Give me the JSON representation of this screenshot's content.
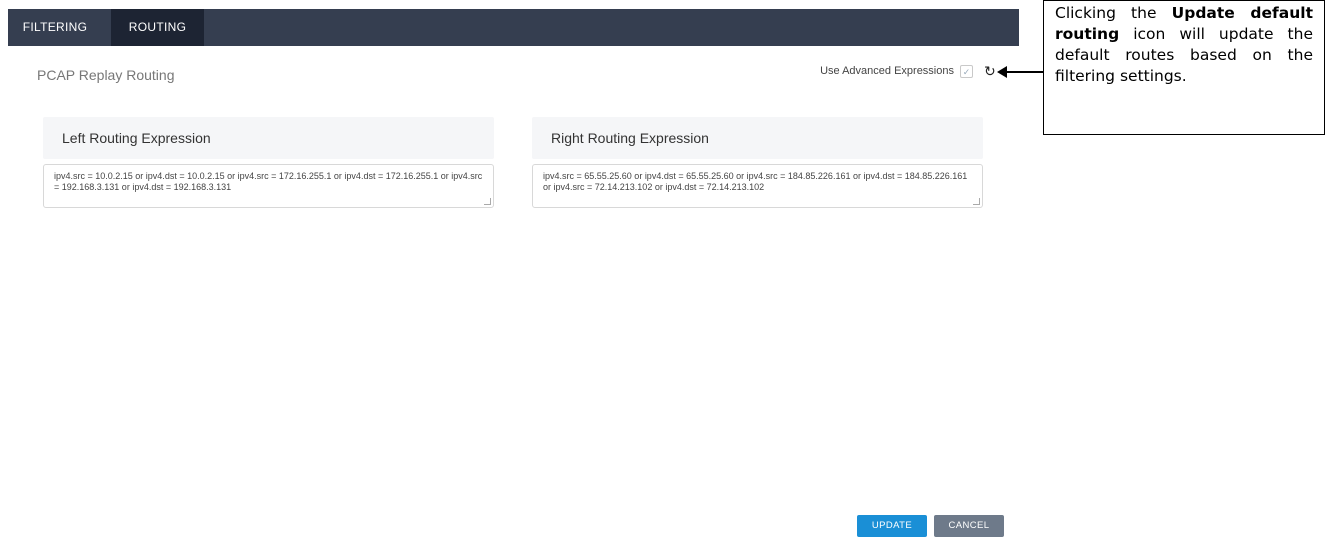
{
  "tabs": {
    "filtering": "FILTERING",
    "routing": "ROUTING"
  },
  "page_title": "PCAP Replay Routing",
  "advanced": {
    "label": "Use Advanced Expressions",
    "checkmark": "✓"
  },
  "icons": {
    "refresh": "↻"
  },
  "callout": {
    "part1": "Clicking the ",
    "bold": "Update default routing",
    "part2": " icon will update the default routes based on the filtering settings."
  },
  "left_panel": {
    "title": "Left Routing Expression",
    "expression": "ipv4.src = 10.0.2.15 or ipv4.dst = 10.0.2.15  or ipv4.src = 172.16.255.1 or ipv4.dst = 172.16.255.1  or ipv4.src = 192.168.3.131 or ipv4.dst = 192.168.3.131"
  },
  "right_panel": {
    "title": "Right Routing Expression",
    "expression": "ipv4.src = 65.55.25.60 or ipv4.dst = 65.55.25.60  or ipv4.src = 184.85.226.161 or ipv4.dst = 184.85.226.161  or ipv4.src = 72.14.213.102 or ipv4.dst = 72.14.213.102"
  },
  "buttons": {
    "update": "UPDATE",
    "cancel": "CANCEL"
  },
  "colors": {
    "tabbar": "#353e50",
    "active_tab": "#1d2433",
    "update_button": "#1a8fd6",
    "cancel_button": "#6e7a8a"
  }
}
